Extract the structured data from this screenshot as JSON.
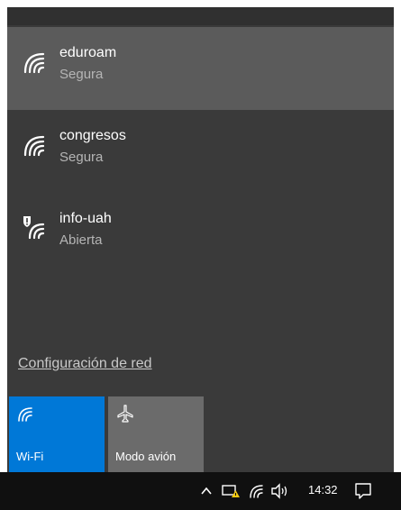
{
  "networks": [
    {
      "name": "eduroam",
      "status": "Segura",
      "icon": "wifi-icon",
      "selected": true
    },
    {
      "name": "congresos",
      "status": "Segura",
      "icon": "wifi-icon",
      "selected": false
    },
    {
      "name": "info-uah",
      "status": "Abierta",
      "icon": "wifi-open-shield-icon",
      "selected": false
    }
  ],
  "settings_link": "Configuración de red",
  "quick_actions": [
    {
      "label": "Wi-Fi",
      "icon": "wifi-icon",
      "active": true,
      "color": "#0078d7"
    },
    {
      "label": "Modo avión",
      "icon": "airplane-icon",
      "active": false,
      "color": "#6b6b6b"
    }
  ],
  "taskbar": {
    "time": "14:32",
    "icons": [
      "chevron-up-icon",
      "network-alert-icon",
      "wifi-icon",
      "volume-icon",
      "action-center-icon"
    ]
  }
}
